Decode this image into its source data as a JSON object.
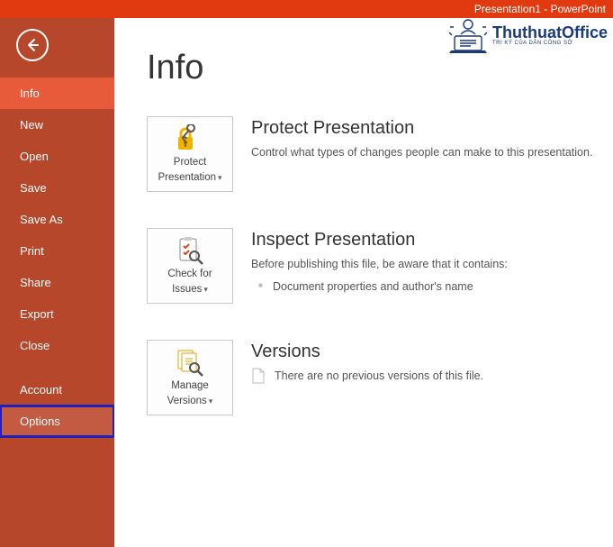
{
  "titlebar": {
    "text": "Presentation1 -  PowerPoint"
  },
  "watermark": {
    "brand": "ThuthuatOffice",
    "tagline": "TRI KỶ CỦA DÂN CÔNG SỞ"
  },
  "sidebar": {
    "items": [
      {
        "label": "Info"
      },
      {
        "label": "New"
      },
      {
        "label": "Open"
      },
      {
        "label": "Save"
      },
      {
        "label": "Save As"
      },
      {
        "label": "Print"
      },
      {
        "label": "Share"
      },
      {
        "label": "Export"
      },
      {
        "label": "Close"
      },
      {
        "label": "Account"
      },
      {
        "label": "Options"
      }
    ]
  },
  "page": {
    "title": "Info"
  },
  "protect": {
    "tile_l1": "Protect",
    "tile_l2": "Presentation",
    "heading": "Protect Presentation",
    "desc": "Control what types of changes people can make to this presentation."
  },
  "inspect": {
    "tile_l1": "Check for",
    "tile_l2": "Issues",
    "heading": "Inspect Presentation",
    "desc": "Before publishing this file, be aware that it contains:",
    "item1": "Document properties and author's name"
  },
  "versions": {
    "tile_l1": "Manage",
    "tile_l2": "Versions",
    "heading": "Versions",
    "desc": "There are no previous versions of this file."
  }
}
